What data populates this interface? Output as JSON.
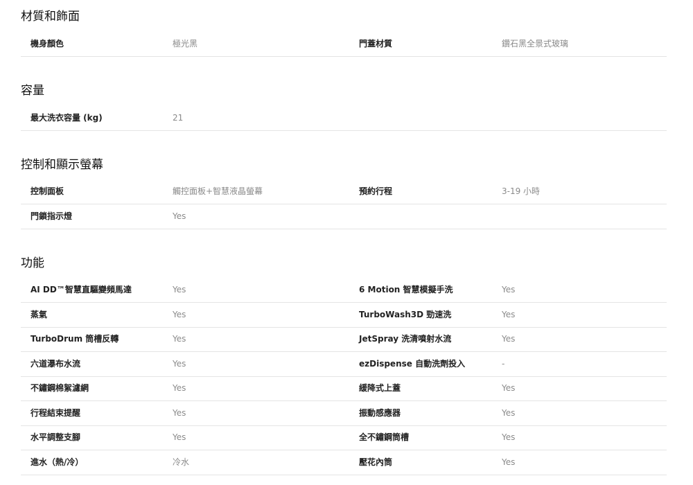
{
  "sections": [
    {
      "title": "材質和飾面",
      "rows": [
        {
          "k1": "機身顏色",
          "v1": "極光黑",
          "k2": "門蓋材質",
          "v2": "鑽石黑全景式玻璃"
        }
      ]
    },
    {
      "title": "容量",
      "rows": [
        {
          "k1": "最大洗衣容量 (kg)",
          "v1": "21"
        }
      ]
    },
    {
      "title": "控制和顯示螢幕",
      "rows": [
        {
          "k1": "控制面板",
          "v1": "觸控面板+智慧液晶螢幕",
          "k2": "預約行程",
          "v2": "3-19 小時"
        },
        {
          "k1": "門鎖指示燈",
          "v1": "Yes"
        }
      ]
    },
    {
      "title": "功能",
      "rows": [
        {
          "k1": "AI DD™智慧直驅變頻馬達",
          "v1": "Yes",
          "k2": "6 Motion 智慧模擬手洗",
          "v2": "Yes"
        },
        {
          "k1": "蒸氣",
          "v1": "Yes",
          "k2": "TurboWash3D 勁速洗",
          "v2": "Yes"
        },
        {
          "k1": "TurboDrum 筒槽反轉",
          "v1": "Yes",
          "k2": "JetSpray 洗清噴射水流",
          "v2": "Yes"
        },
        {
          "k1": "六道瀑布水流",
          "v1": "Yes",
          "k2": "ezDispense 自動洗劑投入",
          "v2": "-"
        },
        {
          "k1": "不鏽鋼棉絮濾網",
          "v1": "Yes",
          "k2": "緩降式上蓋",
          "v2": "Yes"
        },
        {
          "k1": "行程結束提醒",
          "v1": "Yes",
          "k2": "振動感應器",
          "v2": "Yes"
        },
        {
          "k1": "水平調整支腳",
          "v1": "Yes",
          "k2": "全不鏽鋼筒槽",
          "v2": "Yes"
        },
        {
          "k1": "進水（熱/冷）",
          "v1": "冷水",
          "k2": "壓花內筒",
          "v2": "Yes"
        }
      ]
    }
  ]
}
